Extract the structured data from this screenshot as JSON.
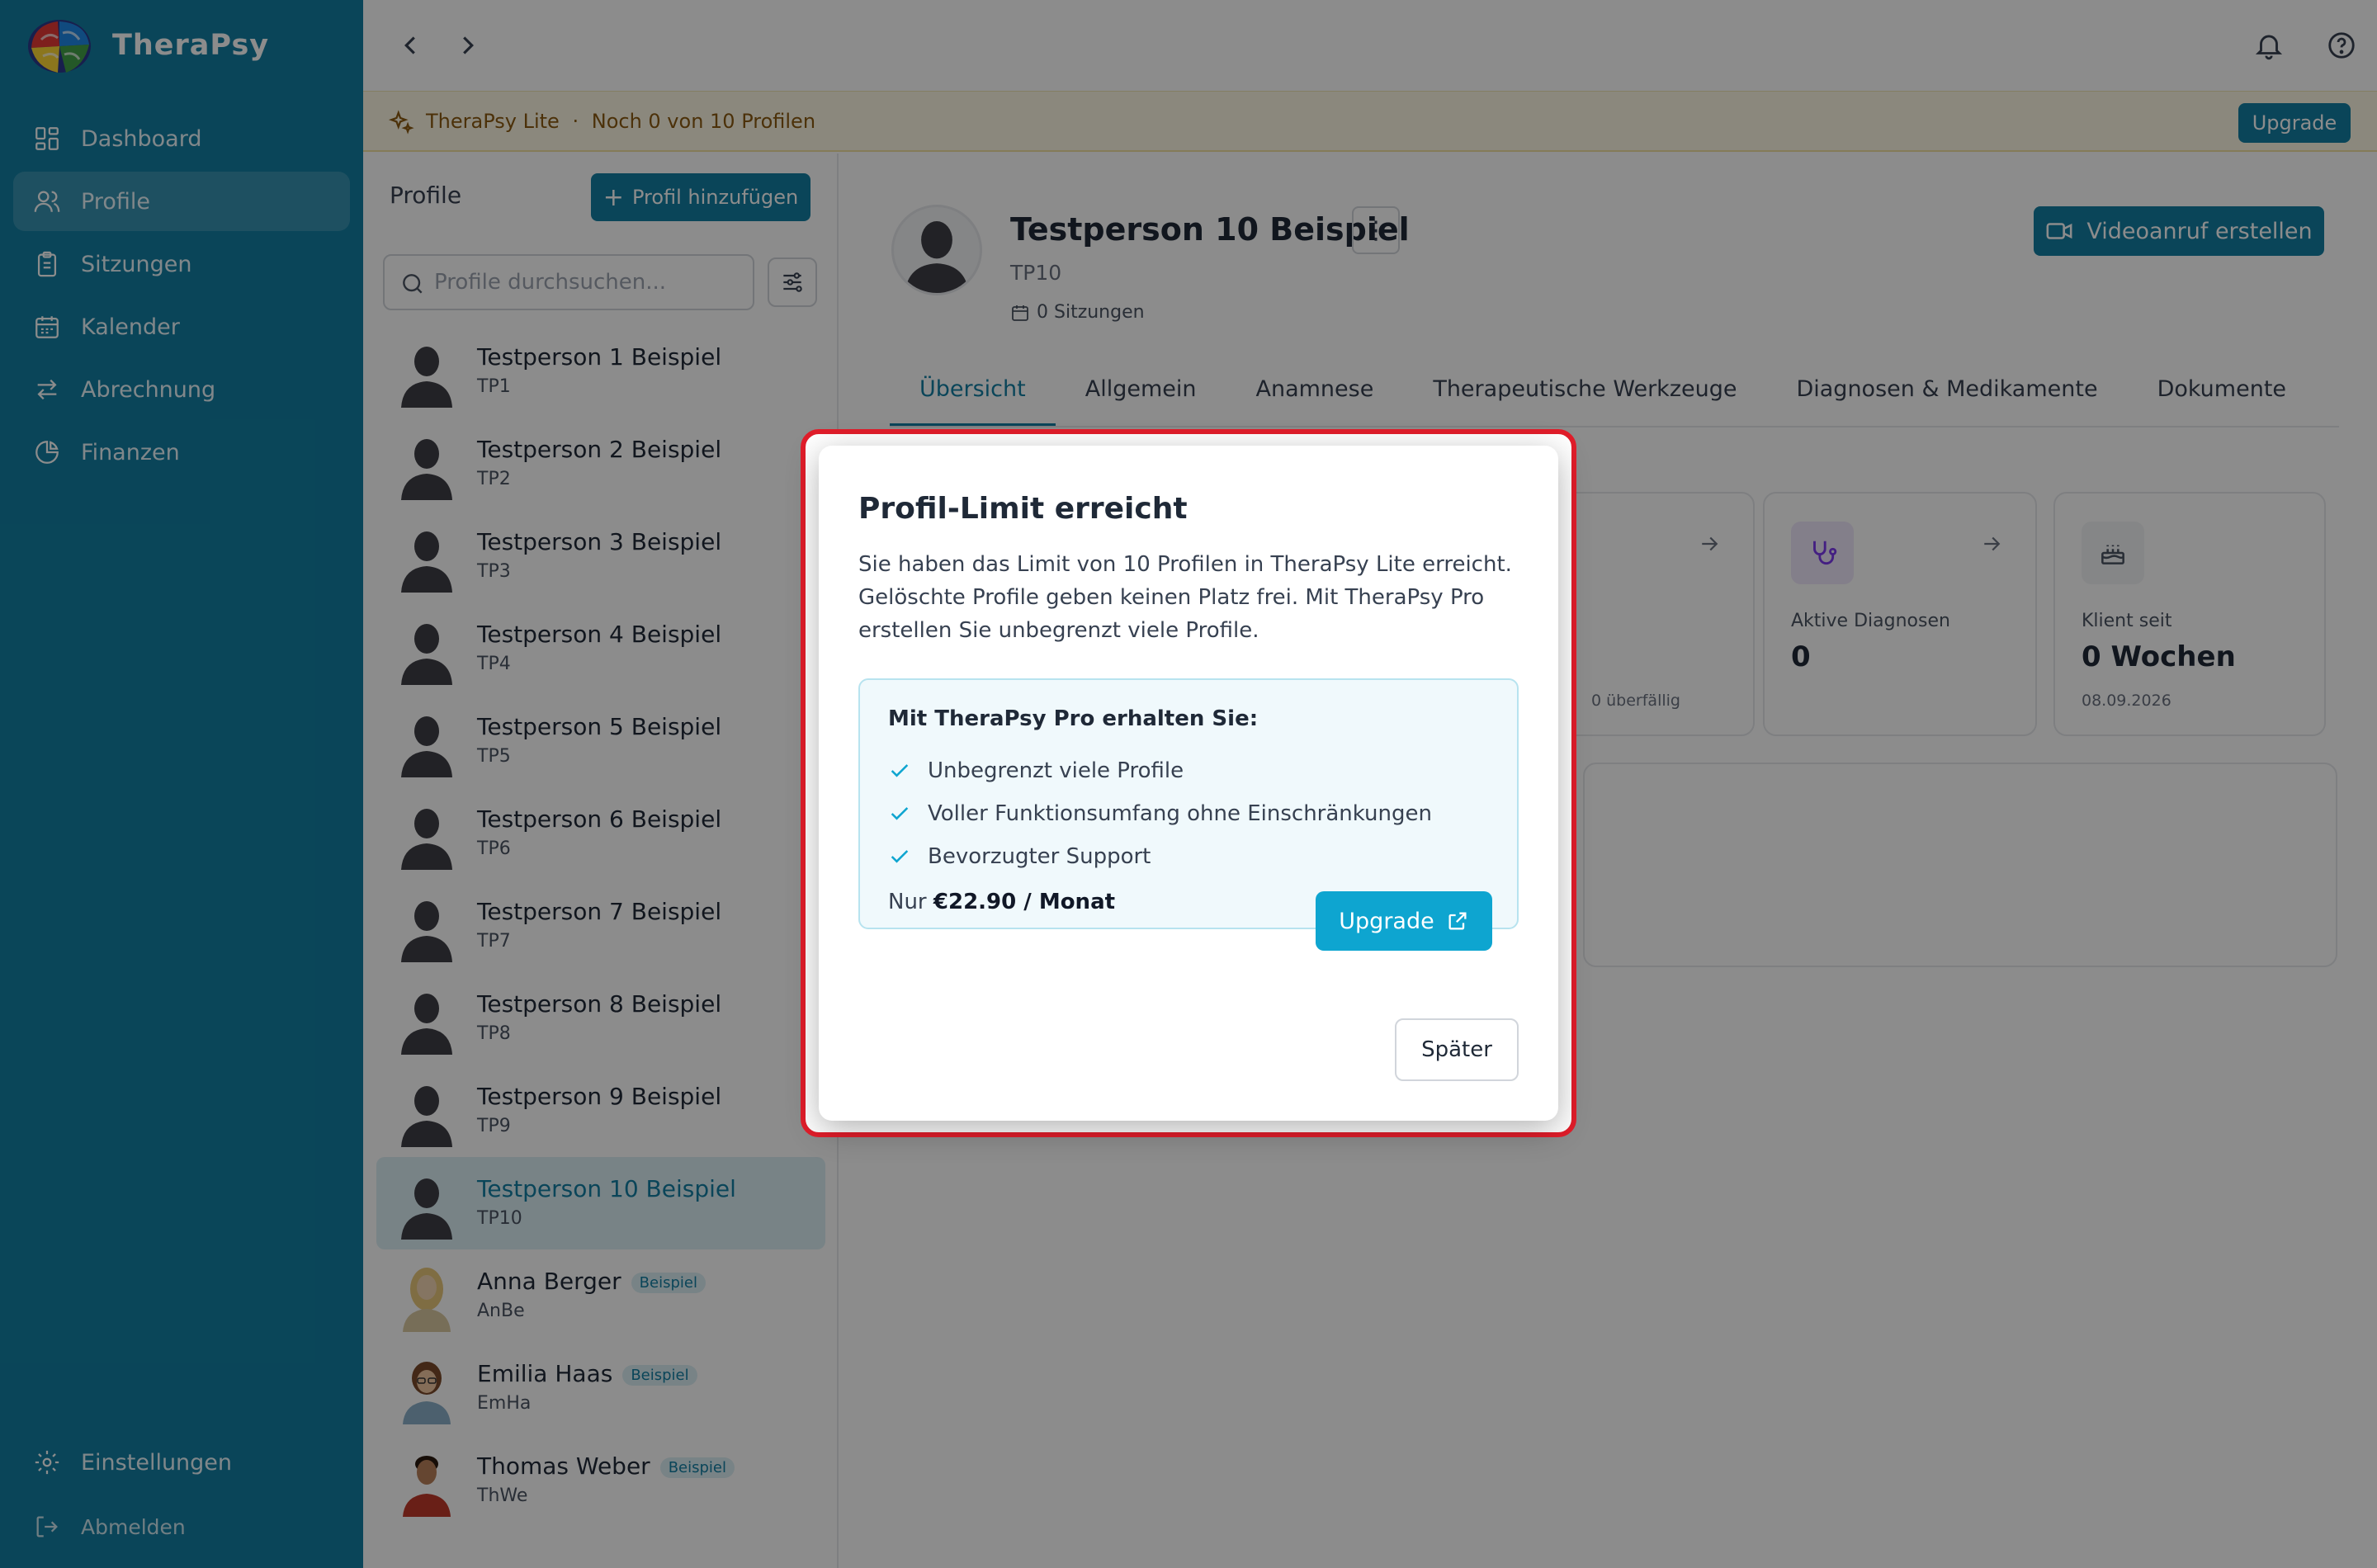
{
  "app": {
    "name": "TheraPsy"
  },
  "sidebar": {
    "items": [
      {
        "label": "Dashboard",
        "icon": "grid-icon"
      },
      {
        "label": "Profile",
        "icon": "users-icon",
        "active": true
      },
      {
        "label": "Sitzungen",
        "icon": "clipboard-icon"
      },
      {
        "label": "Kalender",
        "icon": "calendar-icon"
      },
      {
        "label": "Abrechnung",
        "icon": "arrows-swap-icon"
      },
      {
        "label": "Finanzen",
        "icon": "pie-chart-icon"
      }
    ],
    "settings_label": "Einstellungen",
    "logout_label": "Abmelden"
  },
  "banner": {
    "plan": "TheraPsy Lite",
    "separator": "·",
    "remaining": "Noch 0 von 10 Profilen",
    "upgrade_label": "Upgrade"
  },
  "profile_list": {
    "title": "Profile",
    "add_label": "Profil hinzufügen",
    "search_placeholder": "Profile durchsuchen...",
    "rows": [
      {
        "name": "Testperson 1 Beispiel",
        "code": "TP1"
      },
      {
        "name": "Testperson 2 Beispiel",
        "code": "TP2"
      },
      {
        "name": "Testperson 3 Beispiel",
        "code": "TP3"
      },
      {
        "name": "Testperson 4 Beispiel",
        "code": "TP4"
      },
      {
        "name": "Testperson 5 Beispiel",
        "code": "TP5"
      },
      {
        "name": "Testperson 6 Beispiel",
        "code": "TP6"
      },
      {
        "name": "Testperson 7 Beispiel",
        "code": "TP7"
      },
      {
        "name": "Testperson 8 Beispiel",
        "code": "TP8"
      },
      {
        "name": "Testperson 9 Beispiel",
        "code": "TP9"
      },
      {
        "name": "Testperson 10 Beispiel",
        "code": "TP10",
        "active": true
      },
      {
        "name": "Anna Berger",
        "code": "AnBe",
        "badge": "Beispiel"
      },
      {
        "name": "Emilia Haas",
        "code": "EmHa",
        "badge": "Beispiel"
      },
      {
        "name": "Thomas Weber",
        "code": "ThWe",
        "badge": "Beispiel"
      }
    ]
  },
  "detail": {
    "name": "Testperson 10 Beispiel",
    "more_label": "⋮",
    "code": "TP10",
    "sessions": "0 Sitzungen",
    "video_label": "Videoanruf erstellen",
    "tabs": [
      "Übersicht",
      "Allgemein",
      "Anamnese",
      "Therapeutische Werkzeuge",
      "Diagnosen & Medikamente",
      "Dokumente"
    ],
    "cards": {
      "overdue_fragment": "0 überfällig",
      "diagnoses_label": "Aktive Diagnosen",
      "diagnoses_value": "0",
      "client_since_label": "Klient seit",
      "client_since_value": "0 Wochen",
      "client_since_date": "08.09.2026"
    }
  },
  "modal": {
    "title": "Profil-Limit erreicht",
    "text": "Sie haben das Limit von 10 Profilen in TheraPsy Lite erreicht. Gelöschte Profile geben keinen Platz frei. Mit TheraPsy Pro erstellen Sie unbegrenzt viele Profile.",
    "pro_title": "Mit TheraPsy Pro erhalten Sie:",
    "features": [
      "Unbegrenzt viele Profile",
      "Voller Funktionsumfang ohne Einschränkungen",
      "Bevorzugter Support"
    ],
    "price_prefix": "Nur",
    "price": "€22.90 / Monat",
    "upgrade_label": "Upgrade",
    "later_label": "Später"
  },
  "colors": {
    "primary": "#137fa3",
    "accent": "#0ea5d0",
    "highlight": "#e11d2a",
    "banner_bg": "#fdf8e3"
  }
}
